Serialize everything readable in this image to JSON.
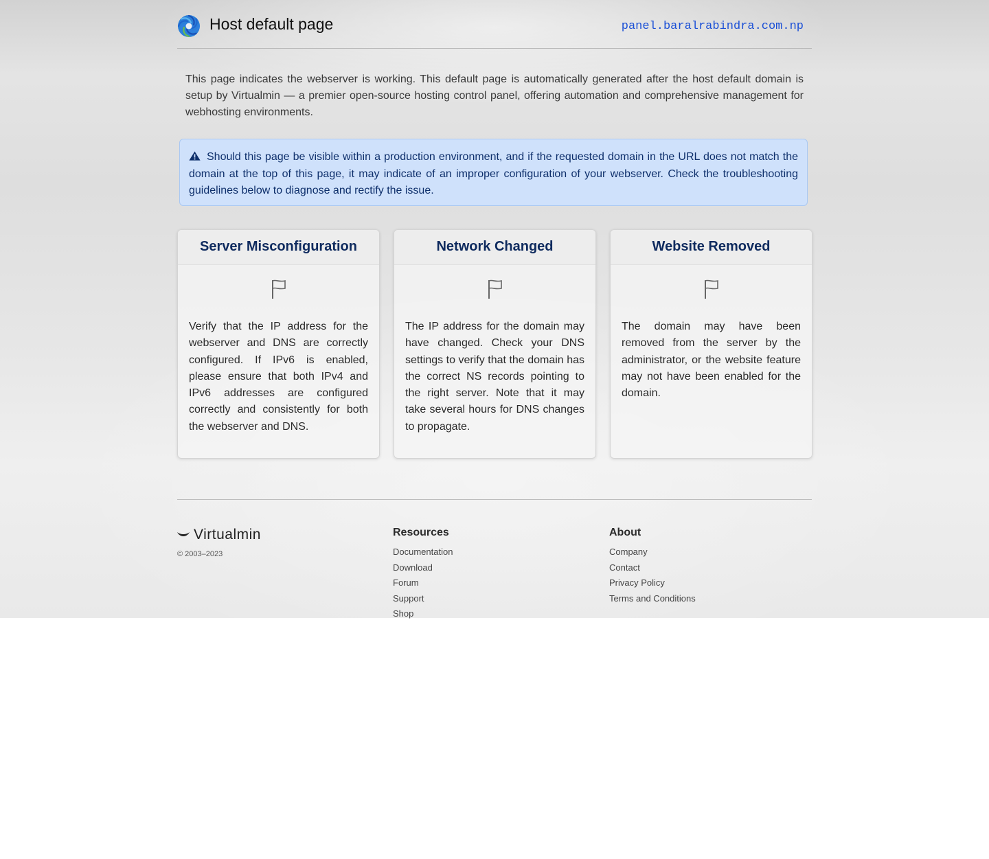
{
  "header": {
    "title": "Host default page",
    "domain": "panel.baralrabindra.com.np"
  },
  "intro": "This page indicates the webserver is working. This default page is automatically generated after the host default domain is setup by Virtualmin — a premier open-source hosting control panel, offering automation and comprehensive management for webhosting environments.",
  "alert": {
    "icon": "warning-icon",
    "text": "Should this page be visible within a production environment, and if the requested domain in the URL does not match the domain at the top of this page, it may indicate of an improper configuration of your webserver. Check the troubleshooting guidelines below to diagnose and rectify the issue."
  },
  "cards": [
    {
      "title": "Server Misconfiguration",
      "icon": "flag-icon",
      "text": "Verify that the IP address for the webserver and DNS are correctly configured. If IPv6 is enabled, please ensure that both IPv4 and IPv6 addresses are configured correctly and consistently for both the webserver and DNS."
    },
    {
      "title": "Network Changed",
      "icon": "flag-icon",
      "text": "The IP address for the domain may have changed. Check your DNS settings to verify that the domain has the correct NS records pointing to the right server. Note that it may take several hours for DNS changes to propagate."
    },
    {
      "title": "Website Removed",
      "icon": "flag-icon",
      "text": "The domain may have been removed from the server by the administrator, or the website feature may not have been enabled for the domain."
    }
  ],
  "footer": {
    "brand": "Virtualmin",
    "copyright": "© 2003–2023",
    "resources": {
      "heading": "Resources",
      "links": [
        "Documentation",
        "Download",
        "Forum",
        "Support",
        "Shop"
      ]
    },
    "about": {
      "heading": "About",
      "links": [
        "Company",
        "Contact",
        "Privacy Policy",
        "Terms and Conditions"
      ]
    }
  },
  "colors": {
    "domain": "#1a4fd6",
    "card_title": "#0e2a5e",
    "alert_bg": "#cfe1fb",
    "alert_text": "#0e2f6b"
  }
}
